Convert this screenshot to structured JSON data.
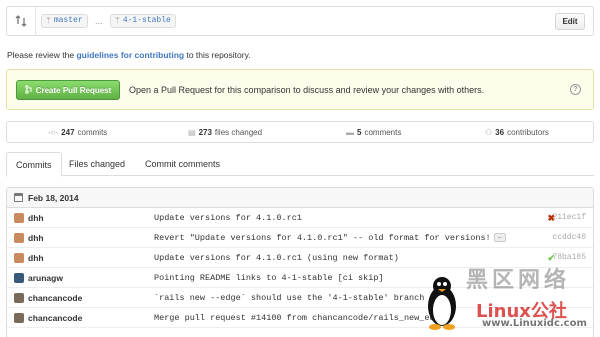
{
  "compare": {
    "base_branch": "master",
    "separator": "...",
    "head_branch": "4-1-stable",
    "edit_label": "Edit"
  },
  "review_notice": {
    "prefix": "Please review the ",
    "link": "guidelines for contributing",
    "suffix": " to this repository."
  },
  "pull_request": {
    "button_label": "Create Pull Request",
    "message": "Open a Pull Request for this comparison to discuss and review your changes with others.",
    "help_icon": "?"
  },
  "stats": {
    "commits_count": "247",
    "commits_label": "commits",
    "files_count": "273",
    "files_label": "files changed",
    "comments_count": "5",
    "comments_label": "comments",
    "contributors_count": "36",
    "contributors_label": "contributors"
  },
  "tabs": [
    {
      "label": "Commits"
    },
    {
      "label": "Files changed"
    },
    {
      "label": "Commit comments"
    }
  ],
  "commit_group": {
    "date": "Feb 18, 2014"
  },
  "commits": [
    {
      "author": "dhh",
      "message": "Update versions for 4.1.0.rc1",
      "sha": "211ec1f",
      "status": "failure",
      "status_color": "#bd2c00",
      "avatar_color": "#c98a5e"
    },
    {
      "author": "dhh",
      "message": "Revert \"Update versions for 4.1.0.rc1\" -- old format for versions!",
      "sha": "ccddc40",
      "status": "none",
      "avatar_color": "#c98a5e"
    },
    {
      "author": "dhh",
      "message": "Update versions for 4.1.0.rc1 (using new format)",
      "sha": "78ba185",
      "status": "success",
      "status_color": "#6cc644",
      "avatar_color": "#c98a5e"
    },
    {
      "author": "arunagw",
      "message": "Pointing README links to 4-1-stable [ci skip]",
      "sha": "",
      "status": "none",
      "avatar_color": "#3a5a7a"
    },
    {
      "author": "chancancode",
      "message": "`rails new --edge` should use the '4-1-stable' branch",
      "sha": "",
      "status": "none",
      "avatar_color": "#7a6a5a"
    },
    {
      "author": "chancancode",
      "message": "Merge pull request #14100 from chancancode/rails_new_edge",
      "sha": "",
      "status": "none",
      "avatar_color": "#7a6a5a"
    }
  ],
  "more_label": "…",
  "watermark": {
    "cn_text": "黑区网络",
    "brand": "Linux公社",
    "site": "www.Linuxidc.com"
  },
  "colors": {
    "link": "#4078c0",
    "pr_button": "#60b044",
    "banner_bg": "#fdfdec"
  },
  "icons": {
    "compare": "compare-icon",
    "branch": "branch-icon",
    "commits": "commits-icon",
    "files": "file-diff-icon",
    "comments": "comment-icon",
    "contributors": "organization-icon",
    "calendar": "calendar-icon",
    "failure": "x-icon",
    "success": "check-icon"
  }
}
